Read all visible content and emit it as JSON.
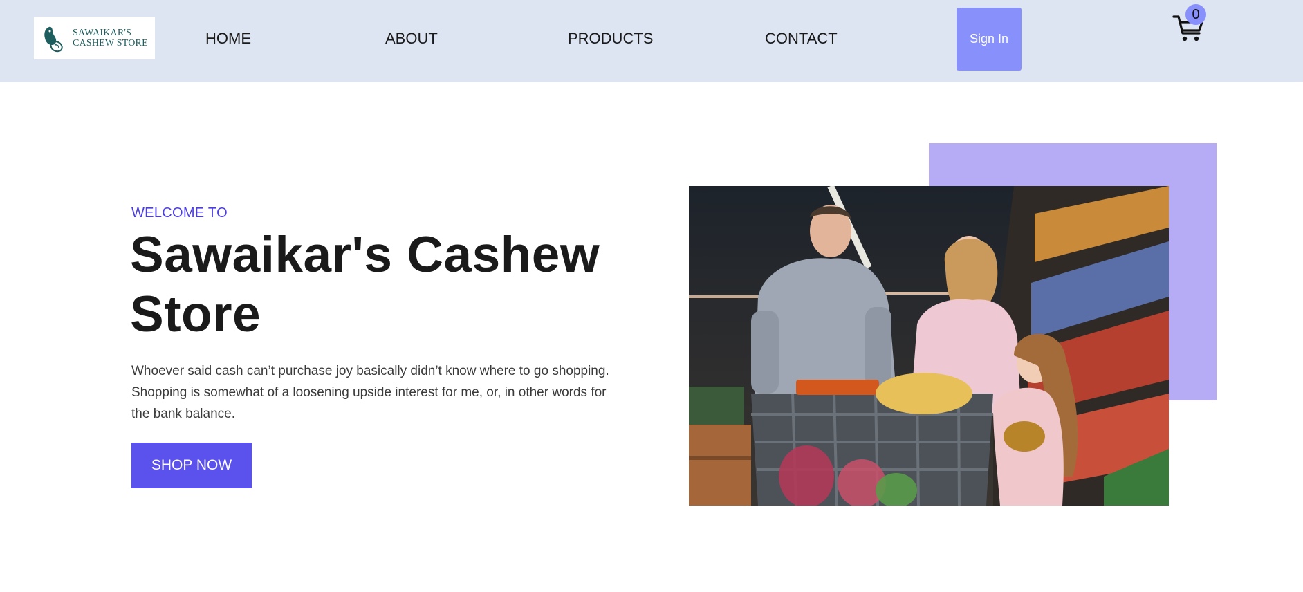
{
  "header": {
    "logo": {
      "line1": "SAWAIKAR'S",
      "line2": "CASHEW STORE",
      "icon": "cashew-logo-icon",
      "color": "#1f5e5e"
    },
    "nav": {
      "home": "HOME",
      "about": "ABOUT",
      "products": "PRODUCTS",
      "contact": "CONTACT"
    },
    "sign_in_label": "Sign In",
    "cart": {
      "icon": "cart-icon",
      "count": "0"
    },
    "background": "#dde5f2"
  },
  "hero": {
    "kicker": "WELCOME TO",
    "title": "Sawaikar's Cashew Store",
    "description": "Whoever said cash can’t purchase joy basically didn’t know where to go shopping. Shopping is somewhat of a loosening upside interest for me, or, in other words for the bank balance.",
    "cta_label": "SHOP NOW",
    "image": "family-grocery-shopping-photo",
    "colors": {
      "accent": "#5b52ee",
      "kicker": "#4b3ee0",
      "accent_block": "#b6acf6",
      "button_secondary": "#8891fb"
    }
  }
}
